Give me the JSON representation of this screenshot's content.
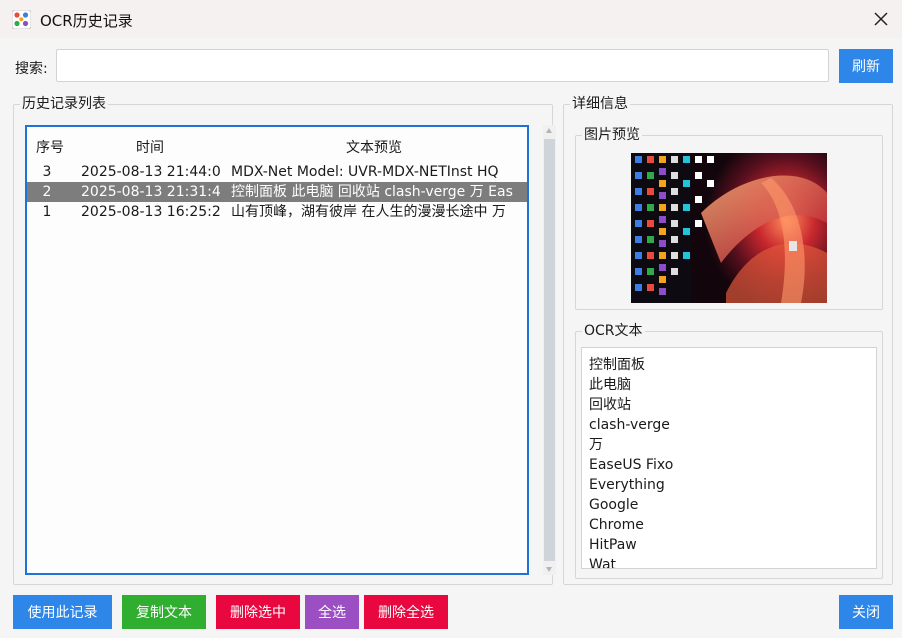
{
  "window": {
    "title": "OCR历史记录"
  },
  "search": {
    "label": "搜索:",
    "value": "",
    "placeholder": "",
    "refresh_label": "刷新"
  },
  "history": {
    "group_title": "历史记录列表",
    "columns": {
      "index": "序号",
      "time": "时间",
      "text": "文本预览"
    },
    "rows": [
      {
        "index": "3",
        "time": "2025-08-13 21:44:0",
        "text": "MDX-Net Model: UVR-MDX-NETInst HQ"
      },
      {
        "index": "2",
        "time": "2025-08-13 21:31:4",
        "text": "控制面板 此电脑 回收站 clash-verge 万 Eas"
      },
      {
        "index": "1",
        "time": "2025-08-13 16:25:2",
        "text": "山有顶峰，湖有彼岸 在人生的漫漫长途中 万"
      }
    ],
    "selected_row": 1
  },
  "detail": {
    "group_title": "详细信息",
    "preview_title": "图片预览",
    "ocr_title": "OCR文本",
    "ocr_lines": [
      "控制面板",
      "此电脑",
      "回收站",
      "clash-verge",
      "万",
      "EaseUS Fixo",
      "Everything",
      "Google",
      "Chrome",
      "HitPaw",
      "Wat"
    ]
  },
  "actions": {
    "use_record": "使用此记录",
    "copy_text": "复制文本",
    "delete_selected": "删除选中",
    "select_all": "全选",
    "delete_all": "删除全选",
    "close": "关闭"
  },
  "colors": {
    "primary_blue": "#2e87e8",
    "green": "#2fae2f",
    "red": "#e8073f",
    "purple": "#9b4fc3",
    "selection_gray": "#7d7d7d",
    "focus_border": "#1e73d8"
  },
  "icons": {
    "app": "app-icon",
    "close": "close-icon"
  }
}
